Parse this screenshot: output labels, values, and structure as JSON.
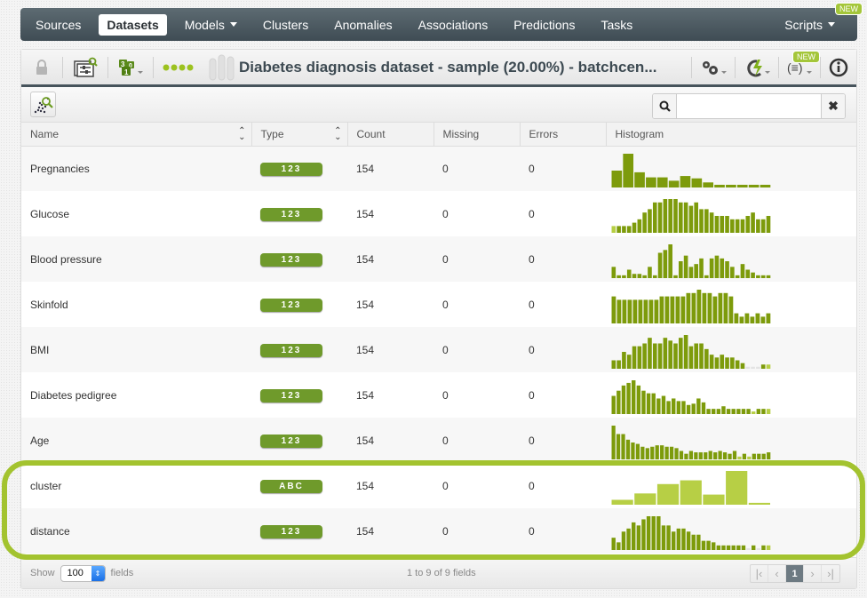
{
  "nav": {
    "items": [
      {
        "label": "Sources",
        "active": false,
        "dropdown": false
      },
      {
        "label": "Datasets",
        "active": true,
        "dropdown": false
      },
      {
        "label": "Models",
        "active": false,
        "dropdown": true
      },
      {
        "label": "Clusters",
        "active": false,
        "dropdown": false
      },
      {
        "label": "Anomalies",
        "active": false,
        "dropdown": false
      },
      {
        "label": "Associations",
        "active": false,
        "dropdown": false
      },
      {
        "label": "Predictions",
        "active": false,
        "dropdown": false
      },
      {
        "label": "Tasks",
        "active": false,
        "dropdown": false
      }
    ],
    "scripts_label": "Scripts",
    "new_badge": "NEW"
  },
  "toolbar": {
    "title": "Diabetes diagnosis dataset - sample (20.00%) - batchcen...",
    "icons": [
      "lock-icon",
      "configure-fields-icon",
      "field-summary-icon",
      "progress-dots-icon",
      "settings-icon",
      "one-click-icon",
      "formula-icon",
      "info-icon"
    ],
    "new_badge": "NEW"
  },
  "search": {
    "placeholder": "",
    "value": ""
  },
  "table": {
    "headers": [
      "Name",
      "Type",
      "Count",
      "Missing",
      "Errors",
      "Histogram"
    ],
    "rows": [
      {
        "name": "Pregnancies",
        "type": "123",
        "count": "154",
        "missing": "0",
        "errors": "0",
        "hist": [
          5,
          10,
          4.5,
          3,
          3,
          2,
          3.4,
          2.7,
          1.5,
          0.8,
          0.8,
          0.8,
          0.8,
          0.8
        ],
        "light": []
      },
      {
        "name": "Glucose",
        "type": "123",
        "count": "154",
        "missing": "0",
        "errors": "0",
        "hist": [
          2,
          2,
          2,
          2,
          3,
          4,
          6,
          7,
          9,
          9,
          10,
          10,
          10,
          9,
          9,
          8,
          9,
          7,
          7,
          6,
          5,
          5,
          5,
          4,
          4,
          4,
          5,
          6,
          4,
          4,
          5
        ],
        "light": [
          0
        ]
      },
      {
        "name": "Blood pressure",
        "type": "123",
        "count": "154",
        "missing": "0",
        "errors": "0",
        "hist": [
          4,
          1,
          1,
          3,
          1.5,
          1.5,
          1,
          4,
          1,
          9,
          10,
          12,
          1,
          6,
          8,
          4,
          5,
          7,
          1,
          7,
          8,
          7,
          6,
          4,
          1,
          5,
          3,
          2,
          1,
          1,
          1
        ],
        "light": []
      },
      {
        "name": "Skinfold",
        "type": "123",
        "count": "154",
        "missing": "0",
        "errors": "0",
        "hist": [
          8,
          7,
          7,
          7,
          7,
          7,
          7,
          7,
          7,
          8,
          8,
          8,
          8,
          8,
          9,
          9,
          10,
          9,
          9,
          8,
          9,
          9,
          8,
          3,
          2,
          3,
          2,
          3,
          2,
          3
        ],
        "light": []
      },
      {
        "name": "BMI",
        "type": "123",
        "count": "154",
        "missing": "0",
        "errors": "0",
        "hist": [
          3,
          3,
          6,
          5,
          8,
          8,
          9,
          11,
          9,
          9,
          11,
          10,
          9,
          11,
          12,
          8,
          9,
          9,
          7,
          5,
          4,
          5,
          4,
          4,
          3,
          2,
          0.7,
          0.7,
          0.7,
          1.5,
          1.5
        ],
        "light": [
          26,
          27,
          28,
          30
        ]
      },
      {
        "name": "Diabetes pedigree",
        "type": "123",
        "count": "154",
        "missing": "0",
        "errors": "0",
        "hist": [
          7,
          9,
          11,
          12,
          13,
          11,
          9,
          8,
          8,
          6,
          7,
          5,
          6,
          5,
          5,
          3.5,
          4,
          6,
          4.5,
          2,
          2,
          2,
          3,
          2,
          2,
          2,
          2,
          2,
          1,
          2,
          2,
          2
        ],
        "light": [
          28,
          31
        ]
      },
      {
        "name": "Age",
        "type": "123",
        "count": "154",
        "missing": "0",
        "errors": "0",
        "hist": [
          12,
          9,
          9,
          7,
          6,
          5.5,
          4.5,
          4,
          4.5,
          5,
          5,
          4.5,
          4.5,
          4,
          3,
          2,
          3,
          2.5,
          2.5,
          2.5,
          3,
          2.5,
          3,
          2.5,
          2,
          3,
          1,
          2,
          1,
          2,
          2,
          2,
          2.5
        ],
        "light": [
          26,
          28
        ]
      },
      {
        "name": "cluster",
        "type": "ABC",
        "count": "154",
        "missing": "0",
        "errors": "0",
        "hist": [
          1.3,
          3,
          5.5,
          6.5,
          2.7,
          9,
          0.5
        ],
        "light": [
          0,
          1,
          2,
          3,
          4,
          5,
          6
        ],
        "categorical": true
      },
      {
        "name": "distance",
        "type": "123",
        "count": "154",
        "missing": "0",
        "errors": "0",
        "hist": [
          4,
          2.5,
          6,
          7,
          9,
          8,
          10,
          11,
          11,
          11,
          8,
          8,
          6,
          7,
          7,
          6,
          5,
          5,
          3,
          3,
          2.5,
          1.5,
          1.5,
          1.5,
          1.5,
          1.5,
          1.5,
          0.6,
          1.5,
          0.6,
          1.5,
          1.5
        ],
        "light": [
          27,
          29,
          31
        ]
      }
    ]
  },
  "footer": {
    "show_label": "Show",
    "show_value": "100",
    "fields_label": "fields",
    "range_text": "1 to 9 of 9 fields",
    "current_page": "1"
  },
  "colors": {
    "histogram_dark": "#7d9b0b",
    "histogram_light": "#b7cf45",
    "histogram_empty": "#e3e3e3",
    "highlight": "#a3c32f",
    "type_badge": "#6f9a2b"
  }
}
